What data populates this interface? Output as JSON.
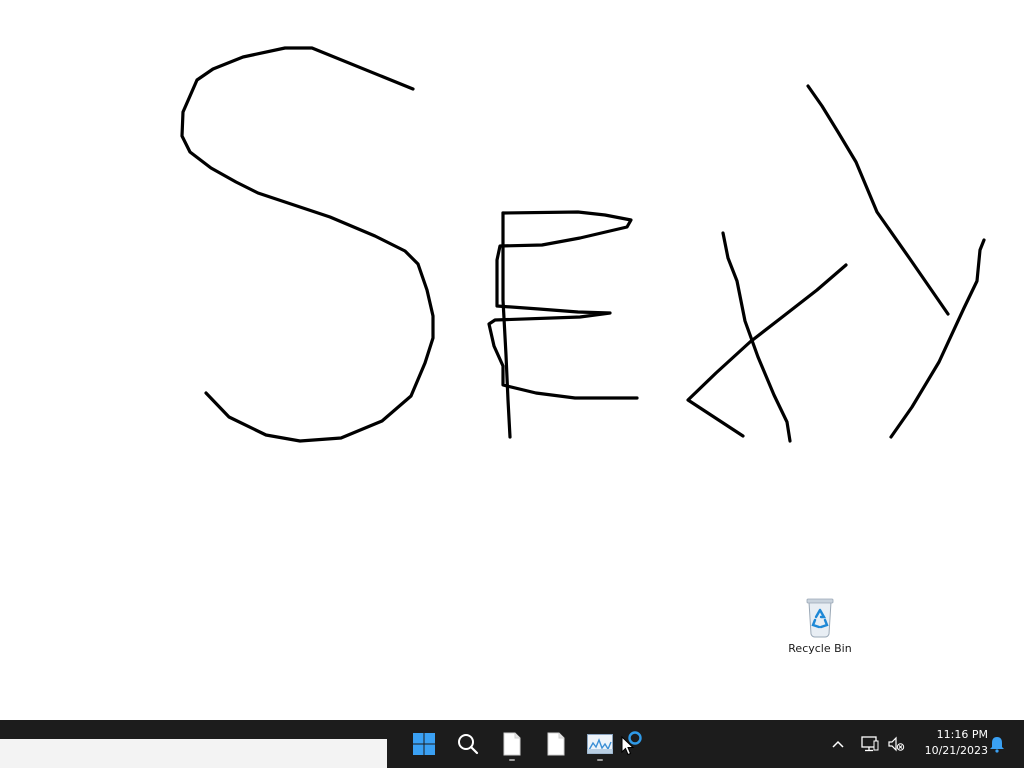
{
  "desktop": {
    "icons": [
      {
        "label": "Recycle Bin",
        "icon": "recycle-bin-icon"
      }
    ],
    "drawing": {
      "text": "Sexy",
      "stroke_color": "#000000"
    }
  },
  "taskbar": {
    "background": "#1c1c1c",
    "apps": [
      {
        "name": "start",
        "icon": "windows-start-icon",
        "accent": "#3aa0f3"
      },
      {
        "name": "search",
        "icon": "search-icon"
      },
      {
        "name": "file-1",
        "icon": "file-icon",
        "running": true
      },
      {
        "name": "file-2",
        "icon": "file-icon",
        "running": false
      },
      {
        "name": "paint",
        "icon": "paint-icon",
        "running": true
      },
      {
        "name": "loading",
        "icon": "loading-ring-icon"
      }
    ],
    "tray": {
      "icons": [
        "chevron-up-icon",
        "network-icon",
        "volume-muted-icon",
        "notification-bell-icon"
      ],
      "time": "11:16 PM",
      "date": "10/21/2023"
    }
  }
}
